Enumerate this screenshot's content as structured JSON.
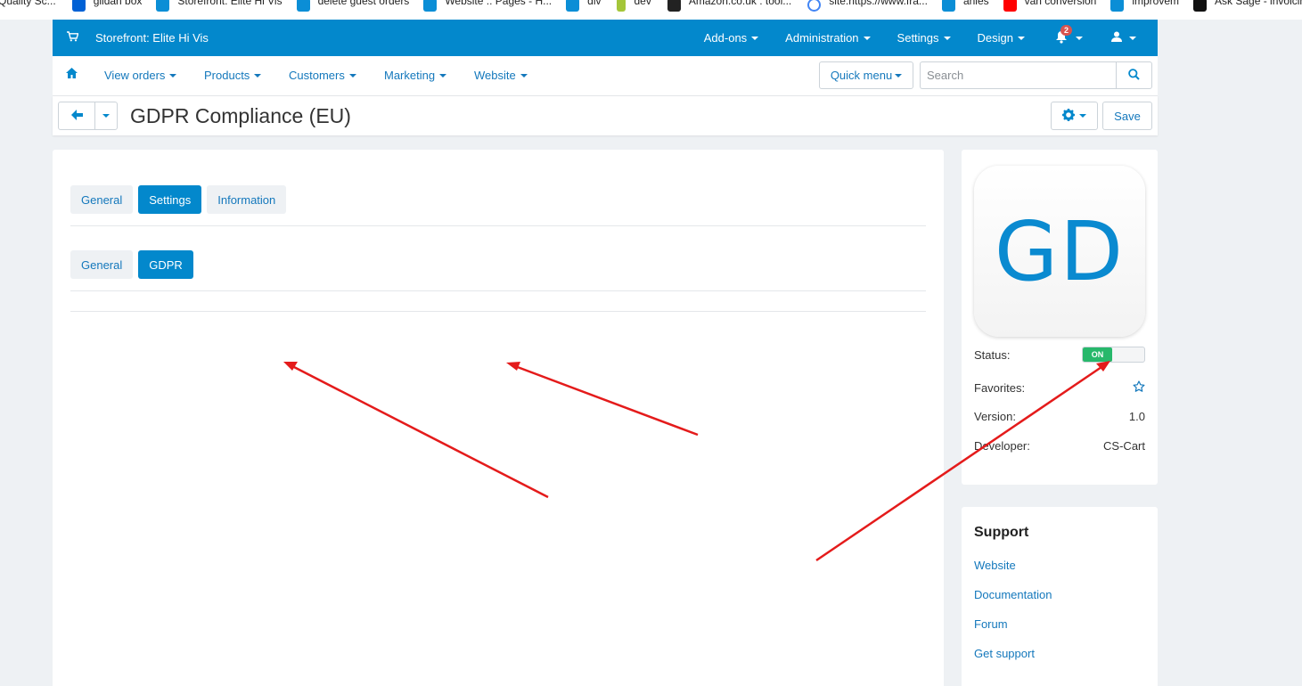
{
  "bookmarks": [
    {
      "label": "Quality Sc...",
      "icon": "document-icon",
      "color": "#ffffff"
    },
    {
      "label": "gildan box",
      "icon": "box-icon",
      "color": "#0061d5"
    },
    {
      "label": "Storefront: Elite Hi Vis",
      "icon": "cscart-icon",
      "color": "#0b8ed6"
    },
    {
      "label": "delete guest orders",
      "icon": "cscart-icon",
      "color": "#0b8ed6"
    },
    {
      "label": "Website :: Pages - H...",
      "icon": "cscart-icon",
      "color": "#0b8ed6"
    },
    {
      "label": "div",
      "icon": "cscart-icon",
      "color": "#0b8ed6"
    },
    {
      "label": "dev",
      "icon": "android-icon",
      "color": "#a4c639"
    },
    {
      "label": "Amazon.co.uk : tool...",
      "icon": "amazon-icon",
      "color": "#222222"
    },
    {
      "label": "site:https://www.fra...",
      "icon": "google-icon",
      "color": "#4285f4"
    },
    {
      "label": "anies",
      "icon": "cscart-icon",
      "color": "#0b8ed6"
    },
    {
      "label": "van conversion",
      "icon": "youtube-icon",
      "color": "#ff0000"
    },
    {
      "label": "improvem",
      "icon": "cscart-icon",
      "color": "#0b8ed6"
    },
    {
      "label": "Ask Sage - invoicin...",
      "icon": "sage-icon",
      "color": "#111111"
    }
  ],
  "topbar": {
    "store": "Storefront: Elite Hi Vis",
    "menu": [
      "Add-ons",
      "Administration",
      "Settings",
      "Design"
    ],
    "notification_count": "2",
    "accent": "#0388cc"
  },
  "nav": {
    "items": [
      "View orders",
      "Products",
      "Customers",
      "Marketing",
      "Website"
    ],
    "quick_menu": "Quick menu",
    "search_placeholder": "Search"
  },
  "page": {
    "title": "GDPR Compliance (EU)",
    "save_label": "Save"
  },
  "tabs": {
    "primary": [
      "General",
      "Settings",
      "Information"
    ],
    "primary_active": "Settings",
    "secondary": [
      "General",
      "GDPR"
    ],
    "secondary_active": "GDPR"
  },
  "addon": {
    "logo_text": "GD",
    "status_label": "Status:",
    "status_value": "ON",
    "favorites_label": "Favorites:",
    "version_label": "Version:",
    "version_value": "1.0",
    "developer_label": "Developer:",
    "developer_value": "CS-Cart"
  },
  "support": {
    "title": "Support",
    "links": [
      "Website",
      "Documentation",
      "Forum",
      "Get support"
    ]
  }
}
